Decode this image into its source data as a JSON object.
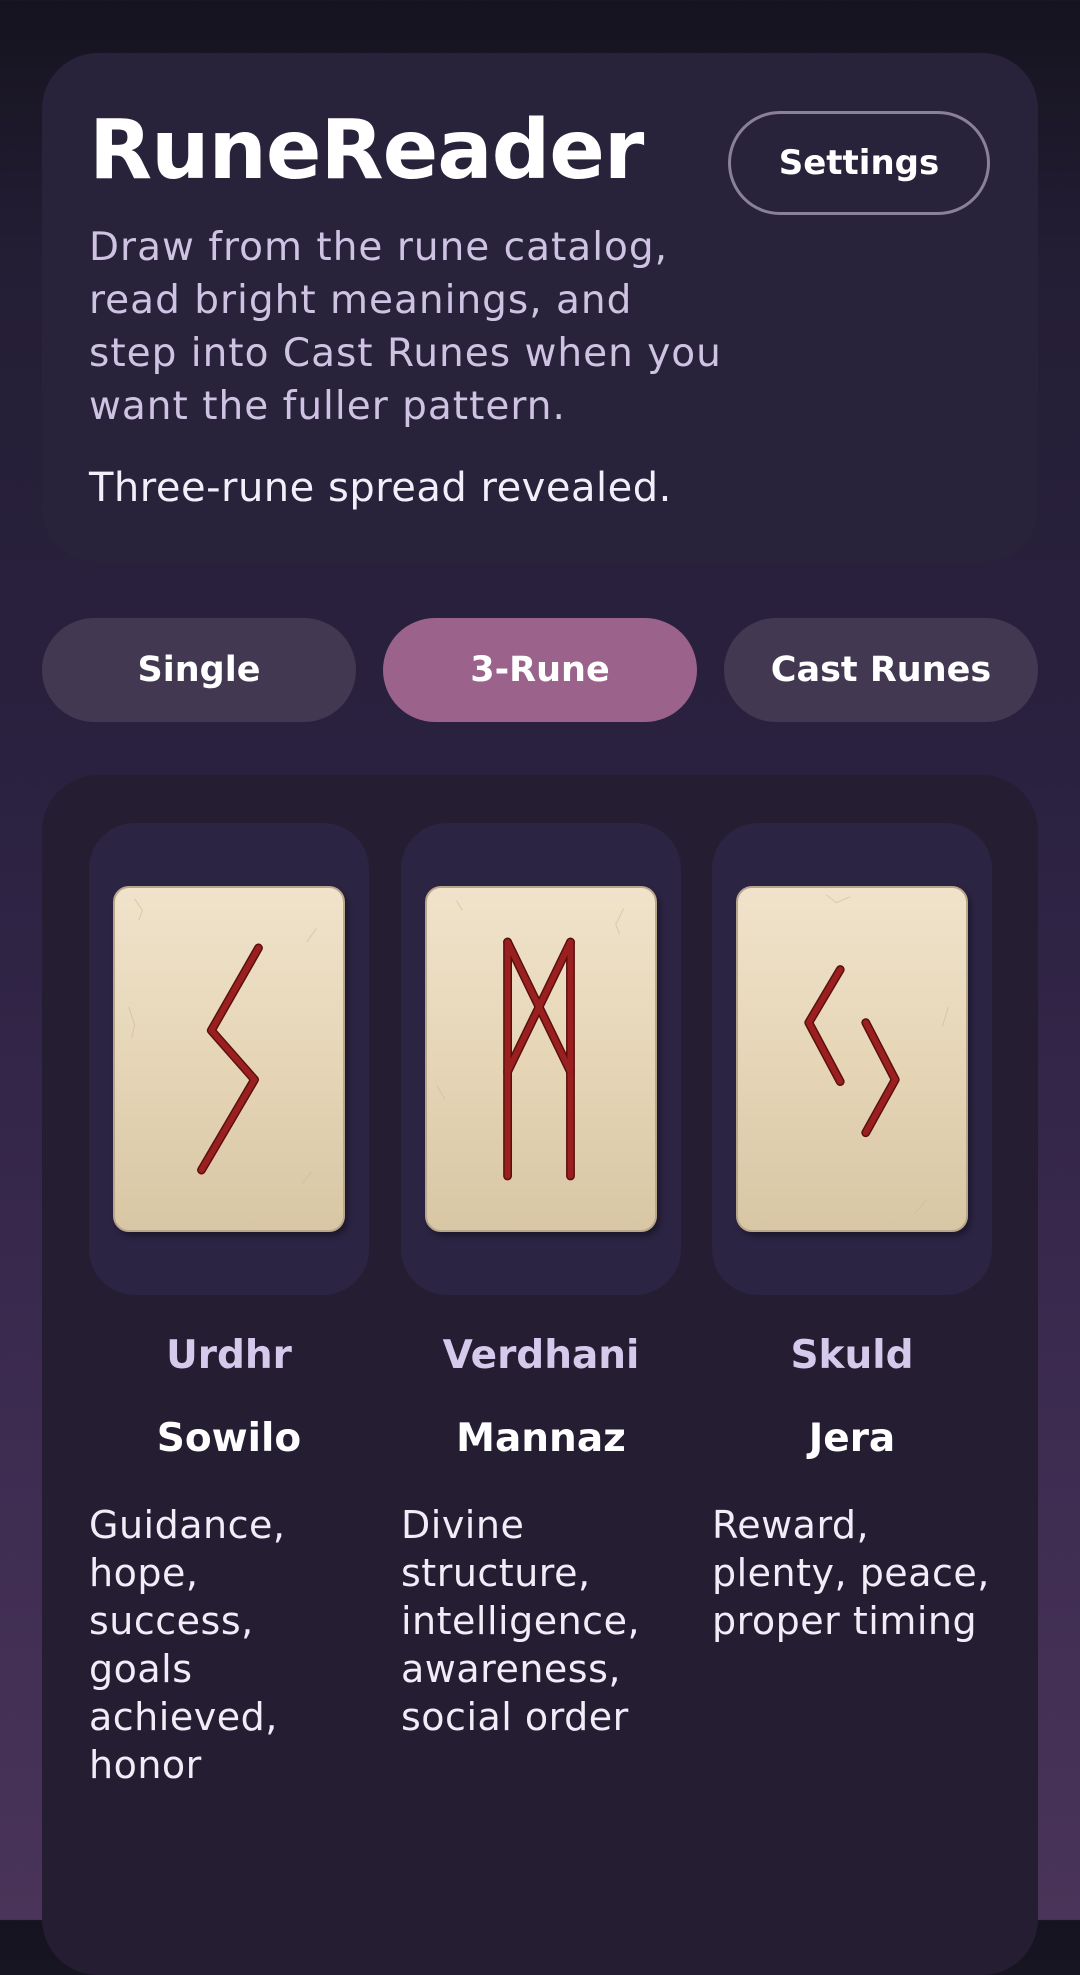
{
  "app": {
    "title": "RuneReader",
    "subtitle": "Draw from the rune catalog, read bright meanings, and step into Cast Runes when you want the fuller pattern.",
    "status": "Three-rune spread revealed."
  },
  "header": {
    "settings_label": "Settings"
  },
  "tabs": [
    {
      "label": "Single",
      "active": false
    },
    {
      "label": "3-Rune",
      "active": true
    },
    {
      "label": "Cast Runes",
      "active": false
    }
  ],
  "spread": {
    "runes": [
      {
        "position": "Urdhr",
        "name": "Sowilo",
        "meaning": "Guidance, hope, success, goals achieved, honor",
        "glyph": "sowilo-rune-icon"
      },
      {
        "position": "Verdhani",
        "name": "Mannaz",
        "meaning": "Divine structure, intelligence, awareness, social order",
        "glyph": "mannaz-rune-icon"
      },
      {
        "position": "Skuld",
        "name": "Jera",
        "meaning": "Reward, plenty, peace, proper timing",
        "glyph": "jera-rune-icon"
      }
    ]
  },
  "colors": {
    "accent": "#9b628c",
    "rune_ink": "#8f1c1c",
    "card_face": "#e6d6b7"
  }
}
